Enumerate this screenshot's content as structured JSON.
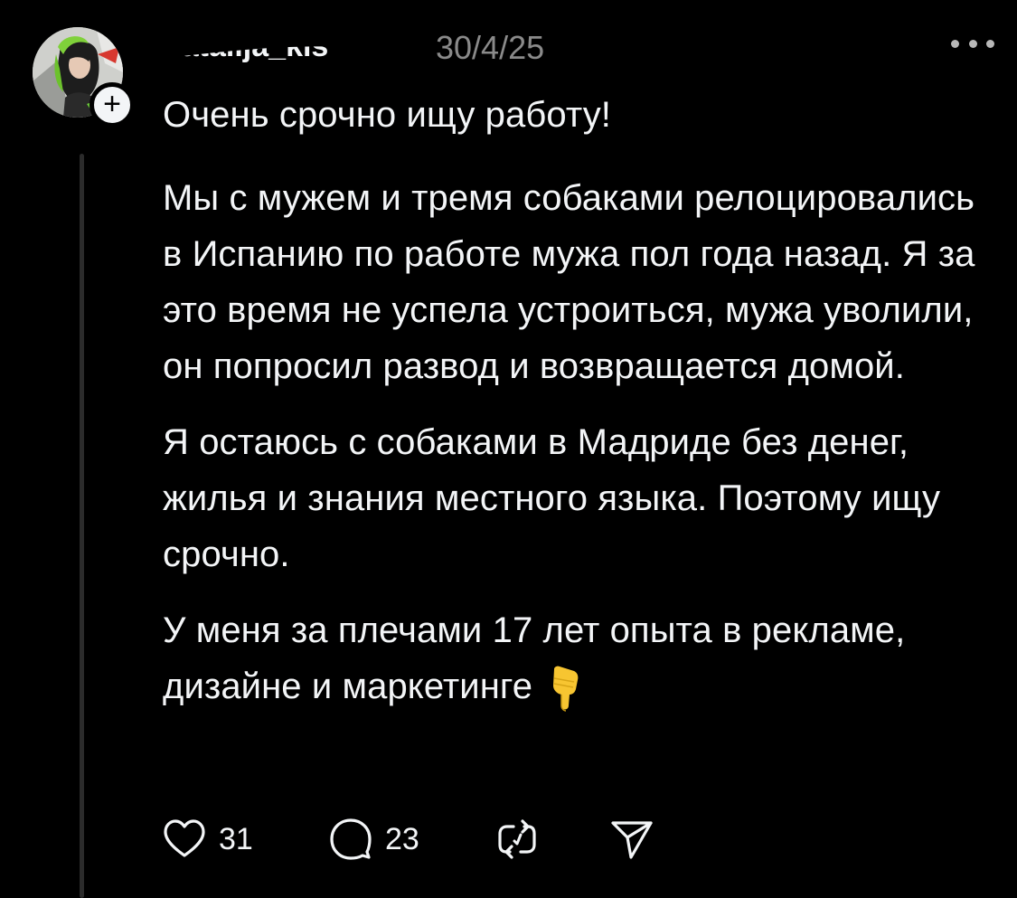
{
  "post": {
    "username": "natalija_kls",
    "date": "30/4/25",
    "title": "Очень срочно ищу работу!",
    "paragraphs": [
      "Мы с мужем и тремя собаками релоцировались в Испанию по работе мужа пол года назад. Я за это время не успела устроиться, мужа уволили, он попросил развод и возвращается домой.",
      "Я остаюсь с собаками в Мадриде без денег, жилья и знания местного языка. Поэтому ищу срочно.",
      "У меня за плечами 17 лет опыта в рекламе, дизайне и маркетинге"
    ],
    "emoji": "pointing-down-hand",
    "follow_badge": "+",
    "actions": {
      "like_count": "31",
      "reply_count": "23"
    }
  },
  "colors": {
    "background": "#000000",
    "text": "#f3f5f7",
    "muted": "#8a8a8a",
    "thread_line": "#2b2b2b",
    "emoji_fill": "#f7c531"
  },
  "icons": [
    "heart-icon",
    "comment-icon",
    "repost-icon",
    "share-icon",
    "more-icon",
    "plus-icon"
  ]
}
